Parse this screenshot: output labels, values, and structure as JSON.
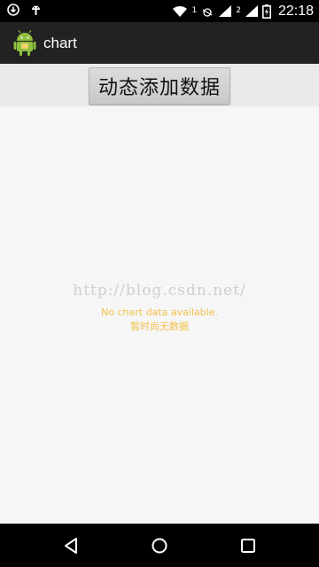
{
  "status_bar": {
    "sim1_label": "1",
    "sim2_label": "2",
    "time": "22:18",
    "icons": [
      "download-icon",
      "android-debug-icon",
      "wifi-icon",
      "signal-icon",
      "battery-icon"
    ]
  },
  "action_bar": {
    "title": "chart",
    "icon": "android-app-icon"
  },
  "toolbar": {
    "add_button_label": "动态添加数据"
  },
  "chart": {
    "watermark": "http://blog.csdn.net/",
    "no_data_text": "No chart data available.",
    "no_data_description": "暂时尚无数据",
    "no_data_color": "#f2c14a"
  },
  "nav_bar": {
    "icons": [
      "back-icon",
      "home-icon",
      "recents-icon"
    ]
  }
}
